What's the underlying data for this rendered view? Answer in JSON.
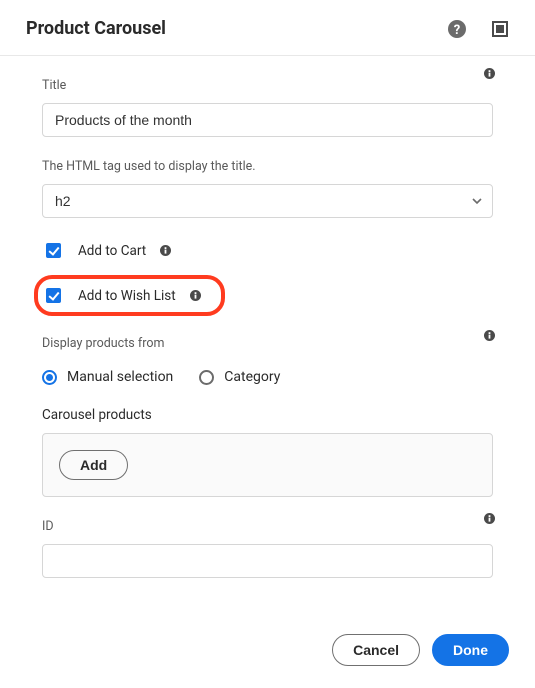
{
  "header": {
    "title": "Product Carousel"
  },
  "title": {
    "label": "Title",
    "value": "Products of the month"
  },
  "htmlTag": {
    "hint": "The HTML tag used to display the title.",
    "value": "h2"
  },
  "addToCart": {
    "label": "Add to Cart",
    "checked": true
  },
  "addToWishList": {
    "label": "Add to Wish List",
    "checked": true
  },
  "displayFrom": {
    "label": "Display products from",
    "selected": "manual",
    "options": {
      "manual": "Manual selection",
      "category": "Category"
    }
  },
  "carouselProducts": {
    "label": "Carousel products",
    "addLabel": "Add"
  },
  "idField": {
    "label": "ID",
    "value": ""
  },
  "footer": {
    "cancel": "Cancel",
    "done": "Done"
  }
}
